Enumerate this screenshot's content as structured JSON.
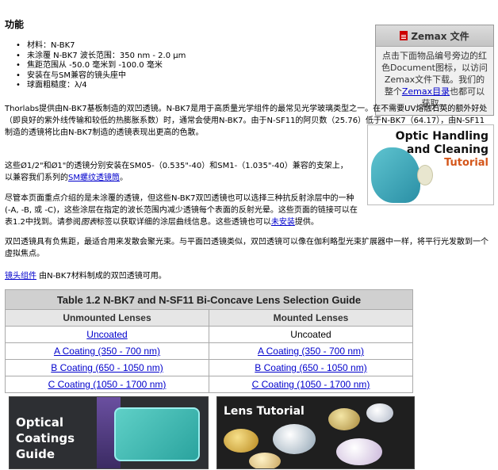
{
  "features": {
    "title": "功能",
    "items": [
      "材料：N-BK7",
      "未涂覆 N-BK7 波长范围：350 nm - 2.0 µm",
      "焦距范围从 -50.0 毫米到 -100.0 毫米",
      "安装在与SM兼容的镜头座中",
      "球面粗糙度：λ/4"
    ]
  },
  "paragraphs": {
    "p1": "Thorlabs提供由N-BK7基板制造的双凹透镜。N-BK7是用于高质量光学组件的最常见光学玻璃类型之一。在不需要UV熔融石英的额外好处（即良好的紫外线传输和较低的热膨胀系数）时，通常会使用N-BK7。由于N-SF11的阿贝数（25.76）低于N-BK7（64.17），由N-SF11制造的透镜将比由N-BK7制造的透镜表现出更高的色散。",
    "p2_pre": "这些Ø1/2\"和Ø1\"的透镜分别安装在SM05-（0.535\"-40）和SM1-（1.035\"-40）兼容的支架上，以兼容我们系列的",
    "p2_link": "SM螺纹透镜筒",
    "p2_post": "。",
    "p3_pre": "尽管本页面重点介绍的是未涂覆的透镜，但这些N-BK7双凹透镜也可以选择三种抗反射涂层中的一种(-A, -B, 或 -C)，这些涂层在指定的波长范围内减少透镜每个表面的反射光晕。这些页面的链接可以在表1.2中找到。请参阅",
    "p3_italic": "图表",
    "p3_mid": "标签以获取详细的涂层曲线信息。这些透镜也可以",
    "p3_link": "未安装",
    "p3_post": "提供。",
    "p4": "双凹透镜具有负焦距，最适合用来发散会聚光束。与平面凹透镜类似，双凹透镜可以像在伽利略型光束扩展器中一样，将平行光发散到一个虚拟焦点。",
    "p5_link": "镜头组件",
    "p5_post": " 由N-BK7材料制成的双凹透镜可用。"
  },
  "zemax": {
    "title": "Zemax 文件",
    "icon": "document-icon",
    "text_pre": "点击下面物品编号旁边的红色Document图标，以访问Zemax文件下载。我们的整个",
    "link": "Zemax目录",
    "text_post": "也都可以获取。"
  },
  "optic_card": {
    "title_line1": "Optic Handling",
    "title_line2": "and Cleaning",
    "subtitle": "Tutorial",
    "accent": "#d4561a"
  },
  "table": {
    "caption": "Table 1.2  N-BK7 and N-SF11 Bi-Concave Lens Selection Guide",
    "headers": [
      "Unmounted Lenses",
      "Mounted Lenses"
    ],
    "rows": [
      [
        "Uncoated",
        "Uncoated"
      ],
      [
        "A Coating (350 - 700 nm)",
        "A Coating (350 - 700 nm)"
      ],
      [
        "B Coating (650 - 1050 nm)",
        "B Coating (650 - 1050 nm)"
      ],
      [
        "C Coating (1050 - 1700 nm)",
        "C Coating (1050 - 1700 nm)"
      ]
    ]
  },
  "banners": {
    "coatings": [
      "Optical",
      "Coatings",
      "Guide"
    ],
    "lens": "Lens Tutorial"
  }
}
